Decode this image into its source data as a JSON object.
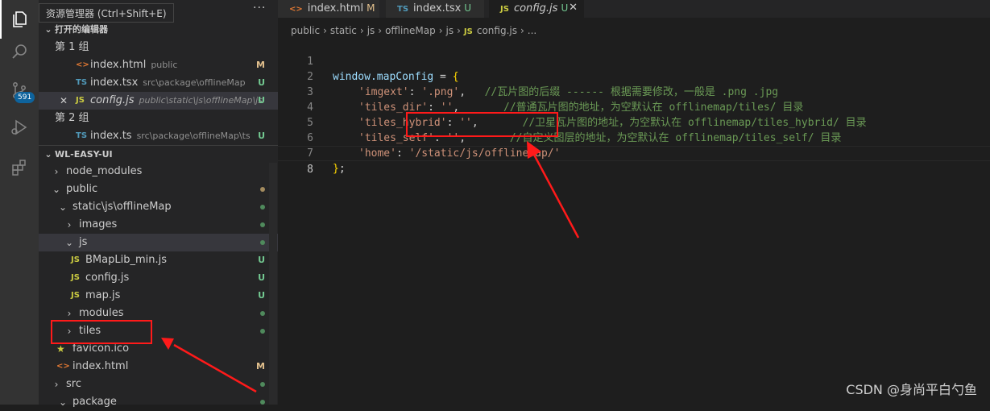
{
  "tooltip": "资源管理器 (Ctrl+Shift+E)",
  "badge": "591",
  "more": "···",
  "open_editors": {
    "title": "打开的编辑器",
    "groups": [
      {
        "label": "第 1 组",
        "files": [
          {
            "icon": "<>",
            "name": "index.html",
            "desc": "public",
            "status": "M"
          },
          {
            "icon": "TS",
            "name": "index.tsx",
            "desc": "src\\package\\offlineMap",
            "status": "U"
          },
          {
            "icon": "JS",
            "name": "config.js",
            "desc": "public\\static\\js\\offlineMap\\js",
            "status": "U",
            "close": "✕"
          }
        ]
      },
      {
        "label": "第 2 组",
        "files": [
          {
            "icon": "TS",
            "name": "index.ts",
            "desc": "src\\package\\offlineMap\\ts",
            "status": "U"
          }
        ]
      }
    ]
  },
  "explorer": {
    "title": "WL-EASY-UI",
    "items": [
      {
        "arrow": "›",
        "name": "node_modules"
      },
      {
        "arrow": "⌄",
        "name": "public"
      },
      {
        "arrow": "⌄",
        "name": "static\\js\\offlineMap"
      },
      {
        "arrow": "›",
        "name": "images"
      },
      {
        "arrow": "⌄",
        "name": "js"
      },
      {
        "icon": "JS",
        "name": "BMapLib_min.js",
        "status": "U"
      },
      {
        "icon": "JS",
        "name": "config.js",
        "status": "U"
      },
      {
        "icon": "JS",
        "name": "map.js",
        "status": "U"
      },
      {
        "arrow": "›",
        "name": "modules"
      },
      {
        "arrow": "›",
        "name": "tiles"
      },
      {
        "icon": "★",
        "name": "favicon.ico"
      },
      {
        "icon": "<>",
        "name": "index.html",
        "status": "M"
      },
      {
        "arrow": "›",
        "name": "src"
      },
      {
        "arrow": "⌄",
        "name": "package"
      }
    ]
  },
  "tabs": [
    {
      "icon": "<>",
      "name": "index.html",
      "status": "M"
    },
    {
      "icon": "TS",
      "name": "index.tsx",
      "status": "U"
    },
    {
      "icon": "JS",
      "name": "config.js",
      "status": "U",
      "close": "✕"
    }
  ],
  "breadcrumb": [
    "public",
    "static",
    "js",
    "offlineMap",
    "js",
    "JS",
    "config.js",
    "..."
  ],
  "code": {
    "line_numbers": [
      "1",
      "2",
      "3",
      "4",
      "5",
      "6",
      "7",
      "8"
    ],
    "l1a": "window.mapConfig",
    "l1b": " = ",
    "l1c": "{",
    "l2a": "'imgext'",
    "l2b": ": ",
    "l2c": "'.png'",
    "l2d": ",   ",
    "l2e": "//瓦片图的后缀 ------ 根据需要修改，一般是 .png .jpg",
    "l3a": "'tiles_dir'",
    "l3b": ": ",
    "l3c": "''",
    "l3d": ",       ",
    "l3e": "//普通瓦片图的地址，为空默认在 offlinemap/tiles/ 目录",
    "l4a": "'tiles_hybrid'",
    "l4b": ": ",
    "l4c": "''",
    "l4d": ",       ",
    "l4e": "//卫星瓦片图的地址，为空默认在 offlinemap/tiles_hybrid/ 目录",
    "l5a": "'tiles_self'",
    "l5b": ": ",
    "l5c": "''",
    "l5d": ",       ",
    "l5e": "//自定义图层的地址，为空默认在 offlinemap/tiles_self/ 目录",
    "l6a": "'home'",
    "l6b": ": ",
    "l6c": "'/static/js/offlineMap/'",
    "l7a": "}",
    "l7b": ";"
  },
  "watermark": "CSDN @身尚平白勺鱼",
  "colors": {
    "annotation": "#ff1a1a"
  }
}
